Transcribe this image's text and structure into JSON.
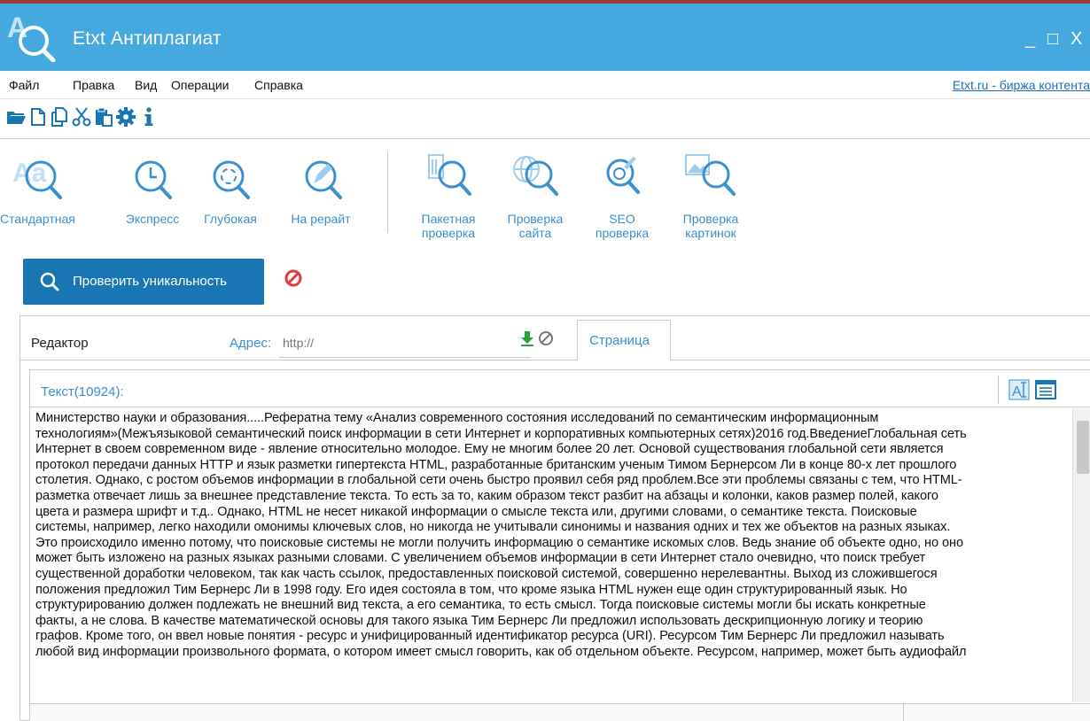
{
  "window": {
    "title": "Etxt Антиплагиат",
    "minimize_label": "_",
    "maximize_label": "□",
    "close_label": "X"
  },
  "menu": {
    "items": [
      "Файл",
      "Правка",
      "Вид",
      "Операции",
      "Справка"
    ],
    "link": "Etxt.ru - биржа контента"
  },
  "ribbon": {
    "group1": [
      {
        "label": "Стандартная",
        "icon": "standard-check-icon"
      },
      {
        "label": "Экспресс",
        "icon": "express-check-icon"
      },
      {
        "label": "Глубокая",
        "icon": "deep-check-icon"
      },
      {
        "label": "На рерайт",
        "icon": "rewrite-check-icon"
      }
    ],
    "group2": [
      {
        "line1": "Пакетная",
        "line2": "проверка",
        "icon": "batch-check-icon"
      },
      {
        "line1": "Проверка",
        "line2": "сайта",
        "icon": "site-check-icon"
      },
      {
        "line1": "SEO",
        "line2": "проверка",
        "icon": "seo-check-icon"
      },
      {
        "line1": "Проверка",
        "line2": "картинок",
        "icon": "image-check-icon"
      }
    ]
  },
  "actions": {
    "check_button": "Проверить уникальность"
  },
  "editor": {
    "tab_label": "Редактор",
    "address_label": "Адрес:",
    "address_placeholder": "http://",
    "page_tab": "Страница",
    "text_header": "Текст(10924):",
    "lines": [
      "Министерство науки и образования.....Рефератна тему «Анализ современного состояния исследований по семантическим информационным",
      "технологиям»(Межъязыковой семантический поиск информации в сети Интернет и корпоративных компьютерных сетях)2016 год.ВведениеГлобальная сеть",
      "Интернет в своем современном виде - явление относительно молодое. Ему не многим более 20 лет. Основой существования глобальной сети является",
      "протокол передачи данных HTTP и язык разметки гипертекста HTML, разработанные британским  ученым Тимом Бернерсом Ли в конце 80-х лет прошлого",
      "столетия. Однако, с ростом объемов информации в глобальной сети очень быстро проявил себя ряд проблем.Все эти проблемы связаны с тем, что HTML-",
      "разметка отвечает лишь за внешнее представление текста.  То есть за то, каким образом текст разбит на абзацы и колонки, каков размер полей, какого",
      "цвета и размера шрифт и т.д.. Однако, HTML не несет никакой информации о смысле текста или, другими словами, о семантике текста. Поисковые",
      "системы, например,  легко находили омонимы ключевых слов, но никогда не учитывали синонимы и названия одних и тех же объектов на разных языках.",
      "Это происходило именно потому, что поисковые системы не могли получить информацию о семантике искомых слов. Ведь знание об объекте одно, но оно",
      "может быть изложено на разных языках разными словами. С увеличением объемов информации в сети Интернет стало очевидно, что поиск требует",
      "существенной доработки человеком, так как часть ссылок, предоставленных поисковой системой, совершенно нерелевантны. Выход из сложившегося",
      "положения предложил Тим Бернерс Ли в 1998 году. Его идея состояла в том, что кроме языка HTML нужен еще один структурированный язык. Но",
      "структурированию должен подлежать не внешний вид текста, а его семантика, то есть смысл. Тогда поисковые системы могли бы искать конкретные",
      "факты, а не слова. В качестве математической основы для такого языка Тим Бернерс Ли предложил использовать дескрипционную логику  и теорию",
      "графов. Кроме того, он ввел новые понятия  - ресурс и унифицированный идентификатор ресурса (URI). Ресурсом Тим Бернерс Ли предложил называть",
      "любой вид информации произвольного формата, о котором имеет смысл говорить, как об отдельном объекте. Ресурсом, например, может быть аудиофайл"
    ]
  },
  "colors": {
    "titlebar": "#45a9e0",
    "accent": "#3a8fce",
    "primary_button": "#1976b2",
    "cancel": "#e53935",
    "download_green": "#2e9e3e"
  }
}
